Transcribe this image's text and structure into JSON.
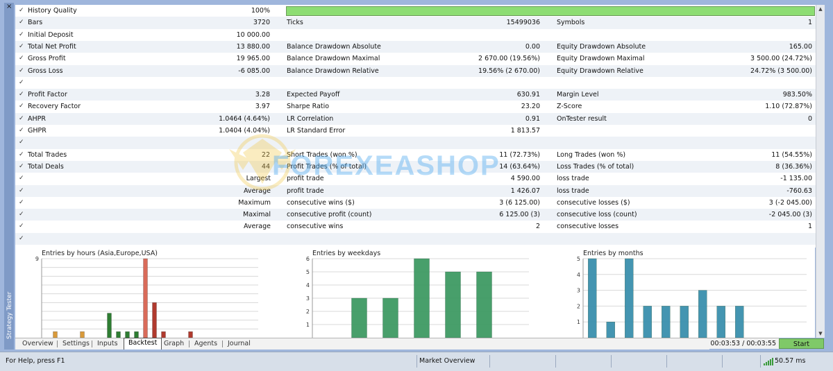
{
  "panel": {
    "close_glyph": "×",
    "vertical_title": "Strategy Tester"
  },
  "quality_bar_pct": 100,
  "rows": [
    {
      "check": "✓",
      "c1": "History Quality",
      "v1": "100%",
      "c2": "",
      "v2": "",
      "c3": "",
      "v3": ""
    },
    {
      "check": "✓",
      "c1": "Bars",
      "v1": "3720",
      "c2": "Ticks",
      "v2": "15499036",
      "c3": "Symbols",
      "v3": "1"
    },
    {
      "check": "✓",
      "c1": "Initial Deposit",
      "v1": "10 000.00",
      "c2": "",
      "v2": "",
      "c3": "",
      "v3": ""
    },
    {
      "check": "✓",
      "c1": "Total Net Profit",
      "v1": "13 880.00",
      "c2": "Balance Drawdown Absolute",
      "v2": "0.00",
      "c3": "Equity Drawdown Absolute",
      "v3": "165.00"
    },
    {
      "check": "✓",
      "c1": "Gross Profit",
      "v1": "19 965.00",
      "c2": "Balance Drawdown Maximal",
      "v2": "2 670.00 (19.56%)",
      "c3": "Equity Drawdown Maximal",
      "v3": "3 500.00 (24.72%)"
    },
    {
      "check": "✓",
      "c1": "Gross Loss",
      "v1": "-6 085.00",
      "c2": "Balance Drawdown Relative",
      "v2": "19.56% (2 670.00)",
      "c3": "Equity Drawdown Relative",
      "v3": "24.72% (3 500.00)"
    },
    {
      "check": "✓",
      "c1": "",
      "v1": "",
      "c2": "",
      "v2": "",
      "c3": "",
      "v3": ""
    },
    {
      "check": "✓",
      "c1": "Profit Factor",
      "v1": "3.28",
      "c2": "Expected Payoff",
      "v2": "630.91",
      "c3": "Margin Level",
      "v3": "983.50%"
    },
    {
      "check": "✓",
      "c1": "Recovery Factor",
      "v1": "3.97",
      "c2": "Sharpe Ratio",
      "v2": "23.20",
      "c3": "Z-Score",
      "v3": "1.10 (72.87%)"
    },
    {
      "check": "✓",
      "c1": "AHPR",
      "v1": "1.0464 (4.64%)",
      "c2": "LR Correlation",
      "v2": "0.91",
      "c3": "OnTester result",
      "v3": "0"
    },
    {
      "check": "✓",
      "c1": "GHPR",
      "v1": "1.0404 (4.04%)",
      "c2": "LR Standard Error",
      "v2": "1 813.57",
      "c3": "",
      "v3": ""
    },
    {
      "check": "✓",
      "c1": "",
      "v1": "",
      "c2": "",
      "v2": "",
      "c3": "",
      "v3": ""
    },
    {
      "check": "✓",
      "c1": "Total Trades",
      "v1": "22",
      "c2": "Short Trades (won %)",
      "v2": "11 (72.73%)",
      "c3": "Long Trades (won %)",
      "v3": "11 (54.55%)"
    },
    {
      "check": "✓",
      "c1": "Total Deals",
      "v1": "44",
      "c2": "Profit Trades (% of total)",
      "v2": "14 (63.64%)",
      "c3": "Loss Trades (% of total)",
      "v3": "8 (36.36%)"
    },
    {
      "check": "✓",
      "c1r": "Largest",
      "c2": "profit trade",
      "v2": "4 590.00",
      "c3": "loss trade",
      "v3": "-1 135.00"
    },
    {
      "check": "✓",
      "c1r": "Average",
      "c2": "profit trade",
      "v2": "1 426.07",
      "c3": "loss trade",
      "v3": "-760.63"
    },
    {
      "check": "✓",
      "c1r": "Maximum",
      "c2": "consecutive wins ($)",
      "v2": "3 (6 125.00)",
      "c3": "consecutive losses ($)",
      "v3": "3 (-2 045.00)"
    },
    {
      "check": "✓",
      "c1r": "Maximal",
      "c2": "consecutive profit (count)",
      "v2": "6 125.00 (3)",
      "c3": "consecutive loss (count)",
      "v3": "-2 045.00 (3)"
    },
    {
      "check": "✓",
      "c1r": "Average",
      "c2": "consecutive wins",
      "v2": "2",
      "c3": "consecutive losses",
      "v3": "1"
    },
    {
      "check": "✓",
      "c1": "",
      "v1": "",
      "c2": "",
      "v2": "",
      "c3": "",
      "v3": ""
    }
  ],
  "watermark": {
    "text": "FOREXEASHOP"
  },
  "chart_data": [
    {
      "type": "bar",
      "title": "Entries by hours (Asia,Europe,USA)",
      "ylim": [
        0,
        9
      ],
      "yticks": [
        "9"
      ],
      "x": [
        1,
        4,
        7,
        8,
        9,
        10,
        11,
        12,
        13,
        16
      ],
      "values": [
        0.7,
        0.7,
        2.8,
        0.7,
        0.7,
        0.7,
        9,
        4,
        0.7,
        0.7
      ],
      "colors": [
        "#d99a3a",
        "#d99a3a",
        "#2e7d32",
        "#2e7d32",
        "#2e7d32",
        "#2e7d32",
        "#d96b5a",
        "#b03a2e",
        "#b03a2e",
        "#b03a2e"
      ]
    },
    {
      "type": "bar",
      "title": "Entries by weekdays",
      "ylim": [
        0,
        6
      ],
      "yticks": [
        "1",
        "2",
        "3",
        "4",
        "5",
        "6"
      ],
      "values": [
        0,
        3,
        3,
        6,
        5,
        5
      ],
      "color": "#3e9a63"
    },
    {
      "type": "bar",
      "title": "Entries by months",
      "ylim": [
        0,
        5
      ],
      "yticks": [
        "1",
        "2",
        "3",
        "4",
        "5"
      ],
      "values": [
        5,
        1,
        5,
        2,
        2,
        2,
        3,
        2,
        2
      ],
      "color": "#3a8fad"
    }
  ],
  "tabs": [
    {
      "label": "Overview",
      "selected": false
    },
    {
      "label": "Settings",
      "selected": false
    },
    {
      "label": "Inputs",
      "selected": false
    },
    {
      "label": "Backtest",
      "selected": true
    },
    {
      "label": "Graph",
      "selected": false
    },
    {
      "label": "Agents",
      "selected": false
    },
    {
      "label": "Journal",
      "selected": false
    }
  ],
  "timer": "00:03:53 / 00:03:55",
  "start_label": "Start",
  "status": {
    "help": "For Help, press F1",
    "market": "Market Overview",
    "ping": "50.57 ms"
  },
  "colors": {
    "start_green": "#7fc968",
    "quality_green": "#8ddd73",
    "frame_blue": "#9fb6dc"
  }
}
